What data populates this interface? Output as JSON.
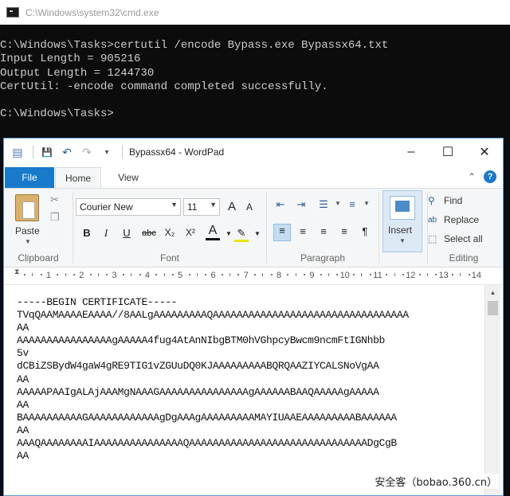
{
  "cmd": {
    "title": "C:\\Windows\\system32\\cmd.exe",
    "lines": [
      "C:\\Windows\\Tasks>certutil /encode Bypass.exe Bypassx64.txt",
      "Input Length = 905216",
      "Output Length = 1244730",
      "CertUtil: -encode command completed successfully.",
      "",
      "C:\\Windows\\Tasks>"
    ]
  },
  "wordpad": {
    "title": "Bypassx64 - WordPad",
    "window_controls": {
      "minimize": "–",
      "maximize": "☐",
      "close": "✕"
    },
    "quick_access": {
      "save": "💾",
      "undo": "↶",
      "redo": "↷",
      "customize": "▾"
    },
    "tabs": {
      "file": "File",
      "home": "Home",
      "view": "View"
    },
    "help": "?",
    "clipboard": {
      "paste": "Paste",
      "label": "Clipboard"
    },
    "font": {
      "family": "Courier New",
      "size": "11",
      "grow": "A",
      "shrink": "A",
      "bold": "B",
      "italic": "I",
      "underline": "U",
      "strikethrough": "abc",
      "subscript": "X₂",
      "superscript": "X²",
      "color": "A",
      "highlight": "✎",
      "label": "Font"
    },
    "paragraph": {
      "label": "Paragraph"
    },
    "insert": {
      "label": "Insert"
    },
    "editing": {
      "find": "Find",
      "replace": "Replace",
      "select_all": "Select all",
      "label": "Editing"
    },
    "ruler_numbers": [
      "1",
      "2",
      "3",
      "4",
      "5",
      "6",
      "7",
      "8",
      "9",
      "10",
      "11",
      "12",
      "13",
      "14"
    ],
    "document_lines": [
      "-----BEGIN CERTIFICATE-----",
      "TVqQAAMAAAAEAAAA//8AALgAAAAAAAAAQAAAAAAAAAAAAAAAAAAAAAAAAAAAAAAAAA",
      "AA",
      "AAAAAAAAAAAAAAAAgAAAAA4fug4AtAnNIbgBTM0hVGhpcyBwcm9ncmFtIGNhbb",
      "5v",
      "dCBiZSBydW4gaW4gRE9TIG1vZGUuDQ0KJAAAAAAAAABQRQAAZIYCALSNoVgAA",
      "AA",
      "AAAAAPAAIgALAjAAAMgNAAAGAAAAAAAAAAAAAAAgAAAAAABAAQAAAAAgAAAAA",
      "AA",
      "BAAAAAAAAAAGAAAAAAAAAAAAgDgAAAgAAAAAAAAAMAYIUAAEAAAAAAAAABAAAAAA",
      "AA",
      "AAAQAAAAAAAAIAAAAAAAAAAAAAAAQAAAAAAAAAAAAAAAAAAAAAAAAAAAAAADgCgB",
      "AA"
    ]
  },
  "watermark": "安全客（bobao.360.cn）"
}
